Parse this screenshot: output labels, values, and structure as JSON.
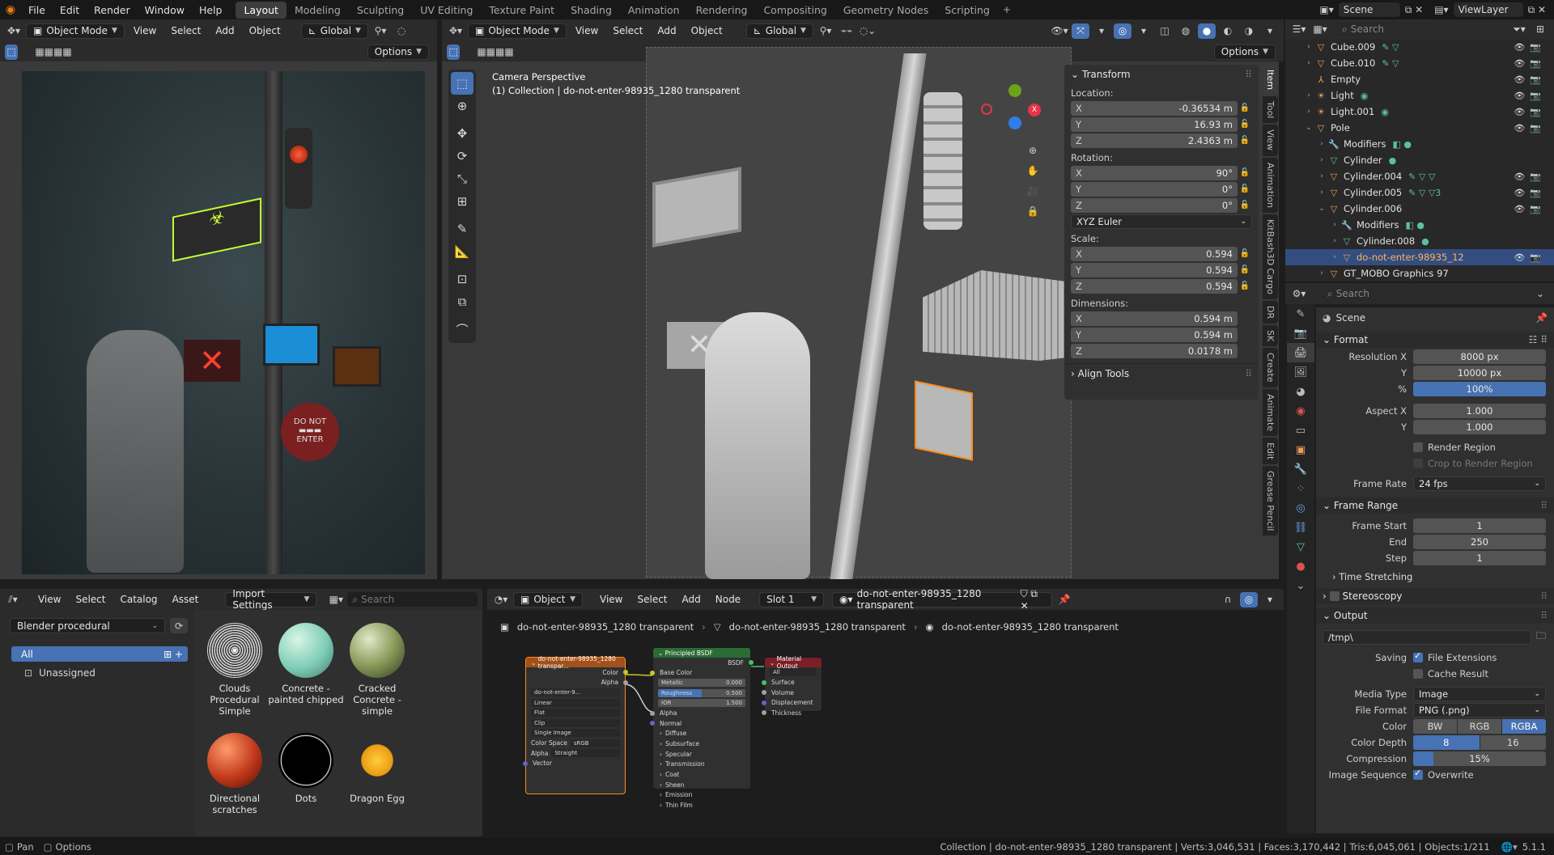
{
  "menu": [
    "File",
    "Edit",
    "Render",
    "Window",
    "Help"
  ],
  "workspaces": [
    "Layout",
    "Modeling",
    "Sculpting",
    "UV Editing",
    "Texture Paint",
    "Shading",
    "Animation",
    "Rendering",
    "Compositing",
    "Geometry Nodes",
    "Scripting"
  ],
  "active_workspace": "Layout",
  "scene_field": "Scene",
  "viewlayer_field": "ViewLayer",
  "left_viewport": {
    "mode": "Object Mode",
    "menus": [
      "View",
      "Select",
      "Add",
      "Object"
    ],
    "orientation": "Global",
    "options": "Options"
  },
  "viewport": {
    "mode": "Object Mode",
    "menus": [
      "View",
      "Select",
      "Add",
      "Object"
    ],
    "orientation": "Global",
    "options": "Options",
    "camera_label": "Camera Perspective",
    "collection_label": "(1) Collection | do-not-enter-98935_1280 transparent"
  },
  "npanel": {
    "transform_title": "Transform",
    "location_label": "Location:",
    "location": [
      {
        "ax": "X",
        "v": "-0.36534 m"
      },
      {
        "ax": "Y",
        "v": "16.93 m"
      },
      {
        "ax": "Z",
        "v": "2.4363 m"
      }
    ],
    "rotation_label": "Rotation:",
    "rotation": [
      {
        "ax": "X",
        "v": "90°"
      },
      {
        "ax": "Y",
        "v": "0°"
      },
      {
        "ax": "Z",
        "v": "0°"
      }
    ],
    "rotation_mode": "XYZ Euler",
    "scale_label": "Scale:",
    "scale": [
      {
        "ax": "X",
        "v": "0.594"
      },
      {
        "ax": "Y",
        "v": "0.594"
      },
      {
        "ax": "Z",
        "v": "0.594"
      }
    ],
    "dimensions_label": "Dimensions:",
    "dimensions": [
      {
        "ax": "X",
        "v": "0.594 m"
      },
      {
        "ax": "Y",
        "v": "0.594 m"
      },
      {
        "ax": "Z",
        "v": "0.0178 m"
      }
    ],
    "align_tools": "Align Tools"
  },
  "side_tabs": [
    "Item",
    "Tool",
    "View",
    "Animation",
    "KitBash3D Cargo",
    "DR",
    "SK",
    "Create",
    "Animate",
    "Edit",
    "Grease Pencil"
  ],
  "outliner": {
    "search_placeholder": "Search",
    "rows": [
      {
        "name": "Cube.009",
        "depth": 1,
        "icon": "▽",
        "color": "#e8a05a",
        "tri": "›",
        "extras": "✎ ▽",
        "vis": true
      },
      {
        "name": "Cube.010",
        "depth": 1,
        "icon": "▽",
        "color": "#e8a05a",
        "tri": "›",
        "extras": "✎ ▽",
        "vis": true
      },
      {
        "name": "Empty",
        "depth": 1,
        "icon": "⅄",
        "color": "#e8a05a",
        "tri": "",
        "extras": "",
        "vis": true
      },
      {
        "name": "Light",
        "depth": 1,
        "icon": "☀",
        "color": "#e8a05a",
        "tri": "›",
        "extras": "◉",
        "vis": true
      },
      {
        "name": "Light.001",
        "depth": 1,
        "icon": "☀",
        "color": "#e8a05a",
        "tri": "›",
        "extras": "◉",
        "vis": true
      },
      {
        "name": "Pole",
        "depth": 1,
        "icon": "▽",
        "color": "#e8a05a",
        "tri": "⌄",
        "extras": "",
        "vis": true
      },
      {
        "name": "Modifiers",
        "depth": 2,
        "icon": "🔧",
        "color": "#6aa0e8",
        "tri": "›",
        "extras": "◧ ●",
        "vis": false
      },
      {
        "name": "Cylinder",
        "depth": 2,
        "icon": "▽",
        "color": "#5bc0a0",
        "tri": "›",
        "extras": "●",
        "vis": false
      },
      {
        "name": "Cylinder.004",
        "depth": 2,
        "icon": "▽",
        "color": "#e8a05a",
        "tri": "›",
        "extras": "✎ ▽ ▽",
        "vis": true
      },
      {
        "name": "Cylinder.005",
        "depth": 2,
        "icon": "▽",
        "color": "#e8a05a",
        "tri": "›",
        "extras": "✎ ▽ ▽3",
        "vis": true
      },
      {
        "name": "Cylinder.006",
        "depth": 2,
        "icon": "▽",
        "color": "#e8a05a",
        "tri": "⌄",
        "extras": "",
        "vis": true
      },
      {
        "name": "Modifiers",
        "depth": 3,
        "icon": "🔧",
        "color": "#6aa0e8",
        "tri": "›",
        "extras": "◧ ●",
        "vis": false
      },
      {
        "name": "Cylinder.008",
        "depth": 3,
        "icon": "▽",
        "color": "#5bc0a0",
        "tri": "›",
        "extras": "●",
        "vis": false
      },
      {
        "name": "do-not-enter-98935_12",
        "depth": 3,
        "icon": "▽",
        "color": "#e8a05a",
        "tri": "›",
        "extras": "",
        "vis": true,
        "selected": true
      },
      {
        "name": "GT_MOBO Graphics 97",
        "depth": 2,
        "icon": "▽",
        "color": "#e8a05a",
        "tri": "›",
        "extras": "",
        "vis": false
      }
    ]
  },
  "properties": {
    "search_placeholder": "Search",
    "scene_name": "Scene",
    "format_title": "Format",
    "resolution_x_label": "Resolution X",
    "resolution_x": "8000 px",
    "resolution_y_label": "Y",
    "resolution_y": "10000 px",
    "resolution_pct_label": "%",
    "resolution_pct": "100%",
    "aspect_x_label": "Aspect X",
    "aspect_x": "1.000",
    "aspect_y_label": "Y",
    "aspect_y": "1.000",
    "render_region": "Render Region",
    "crop_region": "Crop to Render Region",
    "frame_rate_label": "Frame Rate",
    "frame_rate": "24 fps",
    "frame_range_title": "Frame Range",
    "frame_start_label": "Frame Start",
    "frame_start": "1",
    "end_label": "End",
    "end": "250",
    "step_label": "Step",
    "step": "1",
    "time_stretching": "Time Stretching",
    "stereoscopy": "Stereoscopy",
    "output_title": "Output",
    "output_path": "/tmp\\",
    "saving_label": "Saving",
    "file_extensions": "File Extensions",
    "cache_result": "Cache Result",
    "media_type_label": "Media Type",
    "media_type": "Image",
    "file_format_label": "File Format",
    "file_format": "PNG (.png)",
    "color_label": "Color",
    "color_opts": [
      "BW",
      "RGB",
      "RGBA"
    ],
    "color_depth_label": "Color Depth",
    "color_depth_opts": [
      "8",
      "16"
    ],
    "compression_label": "Compression",
    "compression": "15%",
    "compression_level": 0.15,
    "image_sequence_label": "Image Sequence",
    "overwrite": "Overwrite"
  },
  "asset_browser": {
    "menus": [
      "View",
      "Select",
      "Catalog",
      "Asset"
    ],
    "import_settings": "Import Settings",
    "search_placeholder": "Search",
    "library": "Blender procedural",
    "catalogs": [
      "All",
      "Unassigned"
    ],
    "assets": [
      {
        "name": "Clouds Procedural Simple",
        "ball": "clouds"
      },
      {
        "name": "Concrete - painted chipped",
        "ball": "concrete"
      },
      {
        "name": "Cracked Concrete - simple",
        "ball": "cracked"
      },
      {
        "name": "Directional scratches",
        "ball": "scratches"
      },
      {
        "name": "Dots",
        "ball": "dots"
      },
      {
        "name": "Dragon Egg",
        "ball": "dragon"
      }
    ]
  },
  "node_editor": {
    "type": "Object",
    "menus": [
      "View",
      "Select",
      "Add",
      "Node"
    ],
    "slot": "Slot 1",
    "material": "do-not-enter-98935_1280 transparent",
    "breadcrumbs": [
      "do-not-enter-98935_1280 transparent",
      "do-not-enter-98935_1280 transparent",
      "do-not-enter-98935_1280 transparent"
    ],
    "image_node": {
      "title": "do-not-enter-98935_1280 transpar...",
      "out_color": "Color",
      "out_alpha": "Alpha",
      "image": "do-not-enter-9...",
      "interp": "Linear",
      "proj": "Flat",
      "ext": "Clip",
      "source": "Single Image",
      "cs_label": "Color Space",
      "cs": "sRGB",
      "alpha_label": "Alpha",
      "alpha": "Straight",
      "vector": "Vector"
    },
    "bsdf_node": {
      "title": "Principled BSDF",
      "out": "BSDF",
      "base_color": "Base Color",
      "metallic": "Metallic",
      "metallic_v": "0.000",
      "roughness": "Roughness",
      "roughness_v": "0.500",
      "ior": "IOR",
      "ior_v": "1.500",
      "alpha": "Alpha",
      "normal": "Normal",
      "panels": [
        "Diffuse",
        "Subsurface",
        "Specular",
        "Transmission",
        "Coat",
        "Sheen",
        "Emission",
        "Thin Film"
      ]
    },
    "output_node": {
      "title": "Material Output",
      "target": "All",
      "inputs": [
        "Surface",
        "Volume",
        "Displacement",
        "Thickness"
      ]
    }
  },
  "status": {
    "left1": "Pan",
    "left2": "Options",
    "info": "Collection | do-not-enter-98935_1280 transparent | Verts:3,046,531 | Faces:3,170,442 | Tris:6,045,061 | Objects:1/211",
    "version": "5.1.1"
  }
}
